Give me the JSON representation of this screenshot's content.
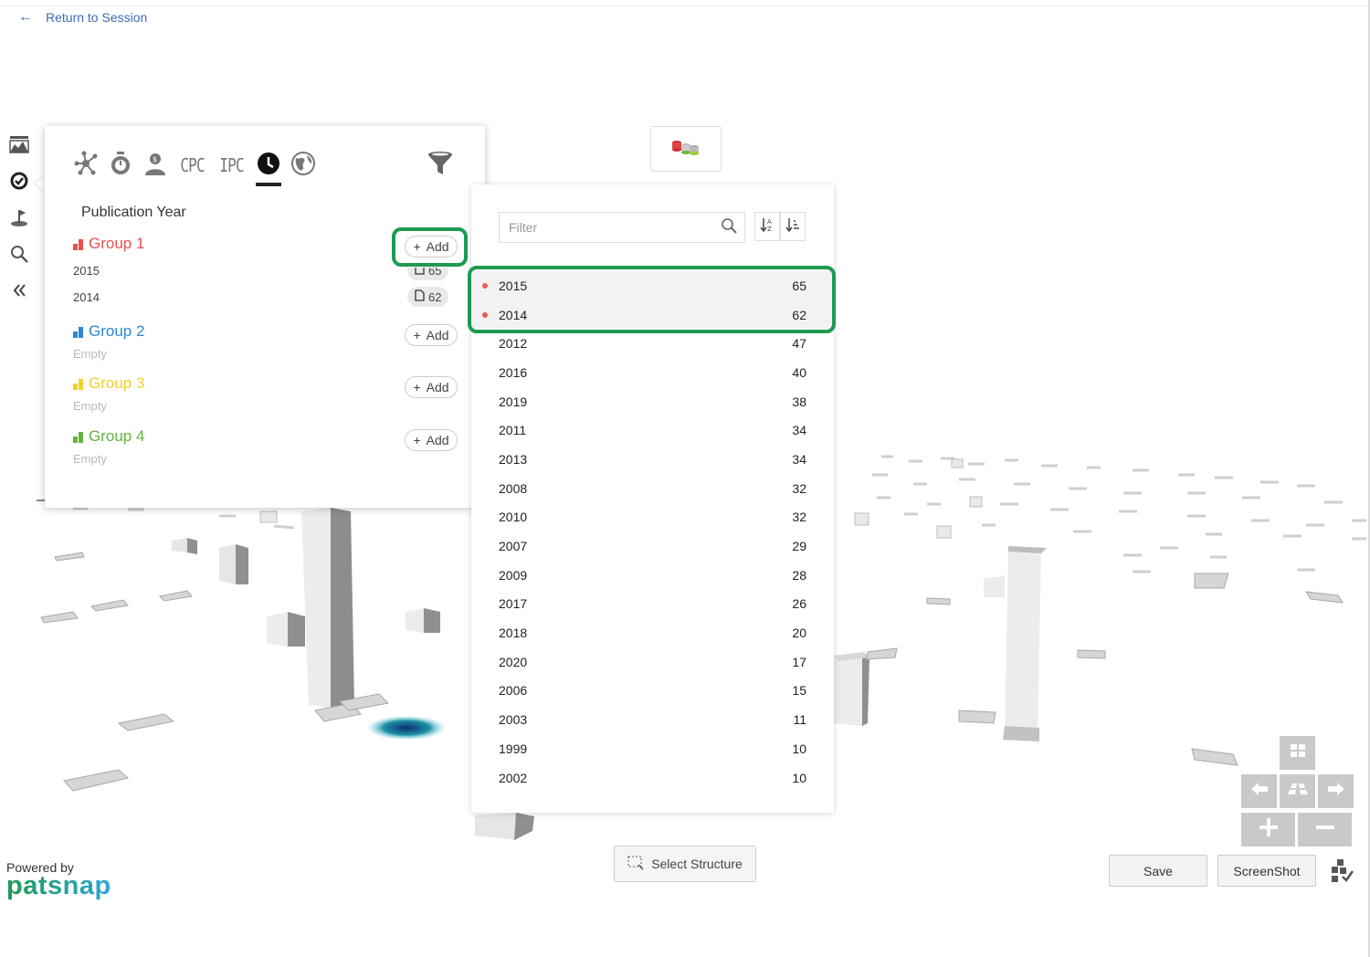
{
  "header": {
    "return_label": "Return to Session"
  },
  "tabs": [
    {
      "icon": "network-icon"
    },
    {
      "icon": "stopwatch-icon"
    },
    {
      "icon": "inventor-icon"
    },
    {
      "label": "CPC"
    },
    {
      "label": "IPC"
    },
    {
      "icon": "clock-icon",
      "active": true
    },
    {
      "icon": "globe-icon"
    }
  ],
  "left_panel": {
    "title": "Publication Year",
    "add_label": "Add",
    "groups": [
      {
        "name": "Group 1",
        "color": "#e8504f",
        "items": [
          {
            "year": "2015",
            "count": "65"
          },
          {
            "year": "2014",
            "count": "62"
          }
        ]
      },
      {
        "name": "Group 2",
        "color": "#2f86d6",
        "empty": "Empty"
      },
      {
        "name": "Group 3",
        "color": "#f2d22e",
        "empty": "Empty"
      },
      {
        "name": "Group 4",
        "color": "#63b43c",
        "empty": "Empty"
      }
    ]
  },
  "right_panel": {
    "filter_placeholder": "Filter",
    "rows": [
      {
        "year": "2015",
        "count": "65",
        "selected": true
      },
      {
        "year": "2014",
        "count": "62",
        "selected": true
      },
      {
        "year": "2012",
        "count": "47"
      },
      {
        "year": "2016",
        "count": "40"
      },
      {
        "year": "2019",
        "count": "38"
      },
      {
        "year": "2011",
        "count": "34"
      },
      {
        "year": "2013",
        "count": "34"
      },
      {
        "year": "2008",
        "count": "32"
      },
      {
        "year": "2010",
        "count": "32"
      },
      {
        "year": "2007",
        "count": "29"
      },
      {
        "year": "2009",
        "count": "28"
      },
      {
        "year": "2017",
        "count": "26"
      },
      {
        "year": "2018",
        "count": "20"
      },
      {
        "year": "2020",
        "count": "17"
      },
      {
        "year": "2006",
        "count": "15"
      },
      {
        "year": "2003",
        "count": "11"
      },
      {
        "year": "1999",
        "count": "10"
      },
      {
        "year": "2002",
        "count": "10"
      }
    ]
  },
  "toolbar": {
    "select_structure": "Select Structure",
    "save": "Save",
    "screenshot": "ScreenShot"
  },
  "branding": {
    "powered_by": "Powered by",
    "logo_text": "patsnap"
  },
  "colors": {
    "highlight": "#1f9a52",
    "accent_blue": "#3a6db3",
    "dot_red": "#e85b5b"
  }
}
